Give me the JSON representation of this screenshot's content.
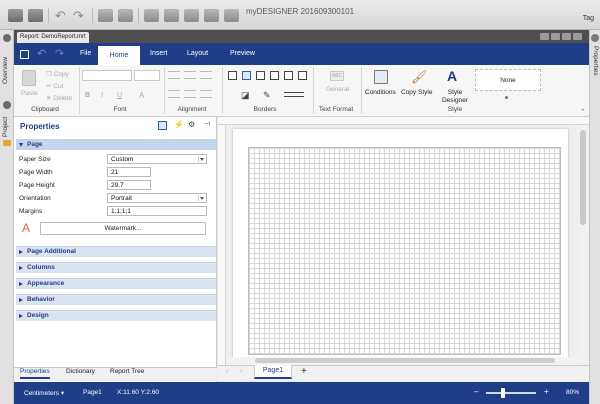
{
  "window": {
    "title": "myDESIGNER 201609300101",
    "tag_label": "Tag"
  },
  "left_rail": {
    "overview": "Overview",
    "project": "Project"
  },
  "right_rail": {
    "properties": "Properties"
  },
  "doc_tab": {
    "label": "Report: DemoReport.mrt"
  },
  "menu": {
    "file": "File",
    "home": "Home",
    "insert": "Insert",
    "layout": "Layout",
    "preview": "Preview"
  },
  "ribbon": {
    "clipboard": {
      "label": "Clipboard",
      "paste": "Paste",
      "copy": "Copy",
      "cut": "Cut",
      "delete": "Delete"
    },
    "font": {
      "label": "Font",
      "bold": "B",
      "italic": "I",
      "underline": "U",
      "font_color": "A"
    },
    "alignment": {
      "label": "Alignment"
    },
    "borders": {
      "label": "Borders"
    },
    "text_format": {
      "label": "Text Format",
      "general": "General",
      "sample": "ABC"
    },
    "style": {
      "label": "Style",
      "conditions": "Conditions",
      "copy_style": "Copy Style",
      "style_designer": "Style Designer",
      "none": "None"
    }
  },
  "properties": {
    "title": "Properties",
    "sections": {
      "page": "Page",
      "page_additional": "Page Additional",
      "columns": "Columns",
      "appearance": "Appearance",
      "behavior": "Behavior",
      "design": "Design"
    },
    "fields": {
      "paper_size": {
        "label": "Paper Size",
        "value": "Custom"
      },
      "page_width": {
        "label": "Page Width",
        "value": "21"
      },
      "page_height": {
        "label": "Page Height",
        "value": "29.7"
      },
      "orientation": {
        "label": "Orientation",
        "value": "Portrait"
      },
      "margins": {
        "label": "Margins",
        "value": "1;1;1;1"
      }
    },
    "watermark_button": "Watermark..."
  },
  "bottom_tabs": {
    "properties": "Properties",
    "dictionary": "Dictionary",
    "report_tree": "Report Tree"
  },
  "page_tabs": {
    "page1": "Page1",
    "add": "+"
  },
  "status": {
    "units": "Centimeters",
    "page": "Page1",
    "coords": "X:11.60 Y:2.60",
    "zoom": "80%",
    "minus": "–",
    "plus": "+"
  },
  "colors": {
    "accent": "#1f3e87"
  }
}
